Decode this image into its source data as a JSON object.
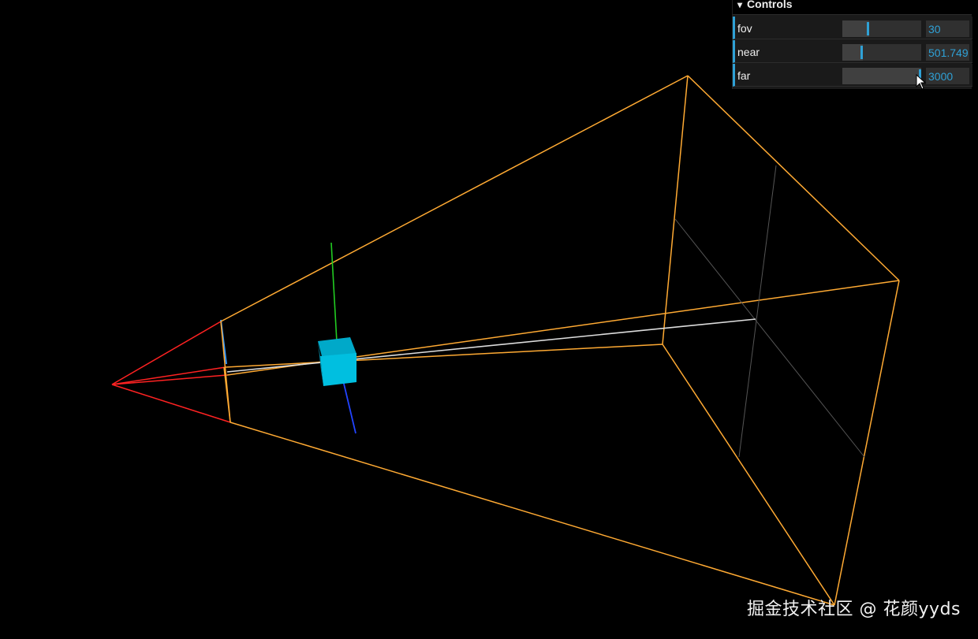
{
  "controls": {
    "title": "Controls",
    "rows": [
      {
        "key": "fov",
        "label": "fov",
        "value": "30",
        "slider_fraction": 0.34
      },
      {
        "key": "near",
        "label": "near",
        "value": "501.749",
        "slider_fraction": 0.26
      },
      {
        "key": "far",
        "label": "far",
        "value": "3000",
        "slider_fraction": 1.0
      }
    ]
  },
  "watermark": "掘金技术社区 @ 花颜yyds",
  "colors": {
    "frustum": "#ffaa33",
    "camera_cone": "#ff2222",
    "axis_y": "#22cc22",
    "axis_z": "#2244ff",
    "up_line": "#3399ff",
    "target_line": "#dddddd",
    "cube": "#00bfe0",
    "accent": "#2fa1d6"
  }
}
